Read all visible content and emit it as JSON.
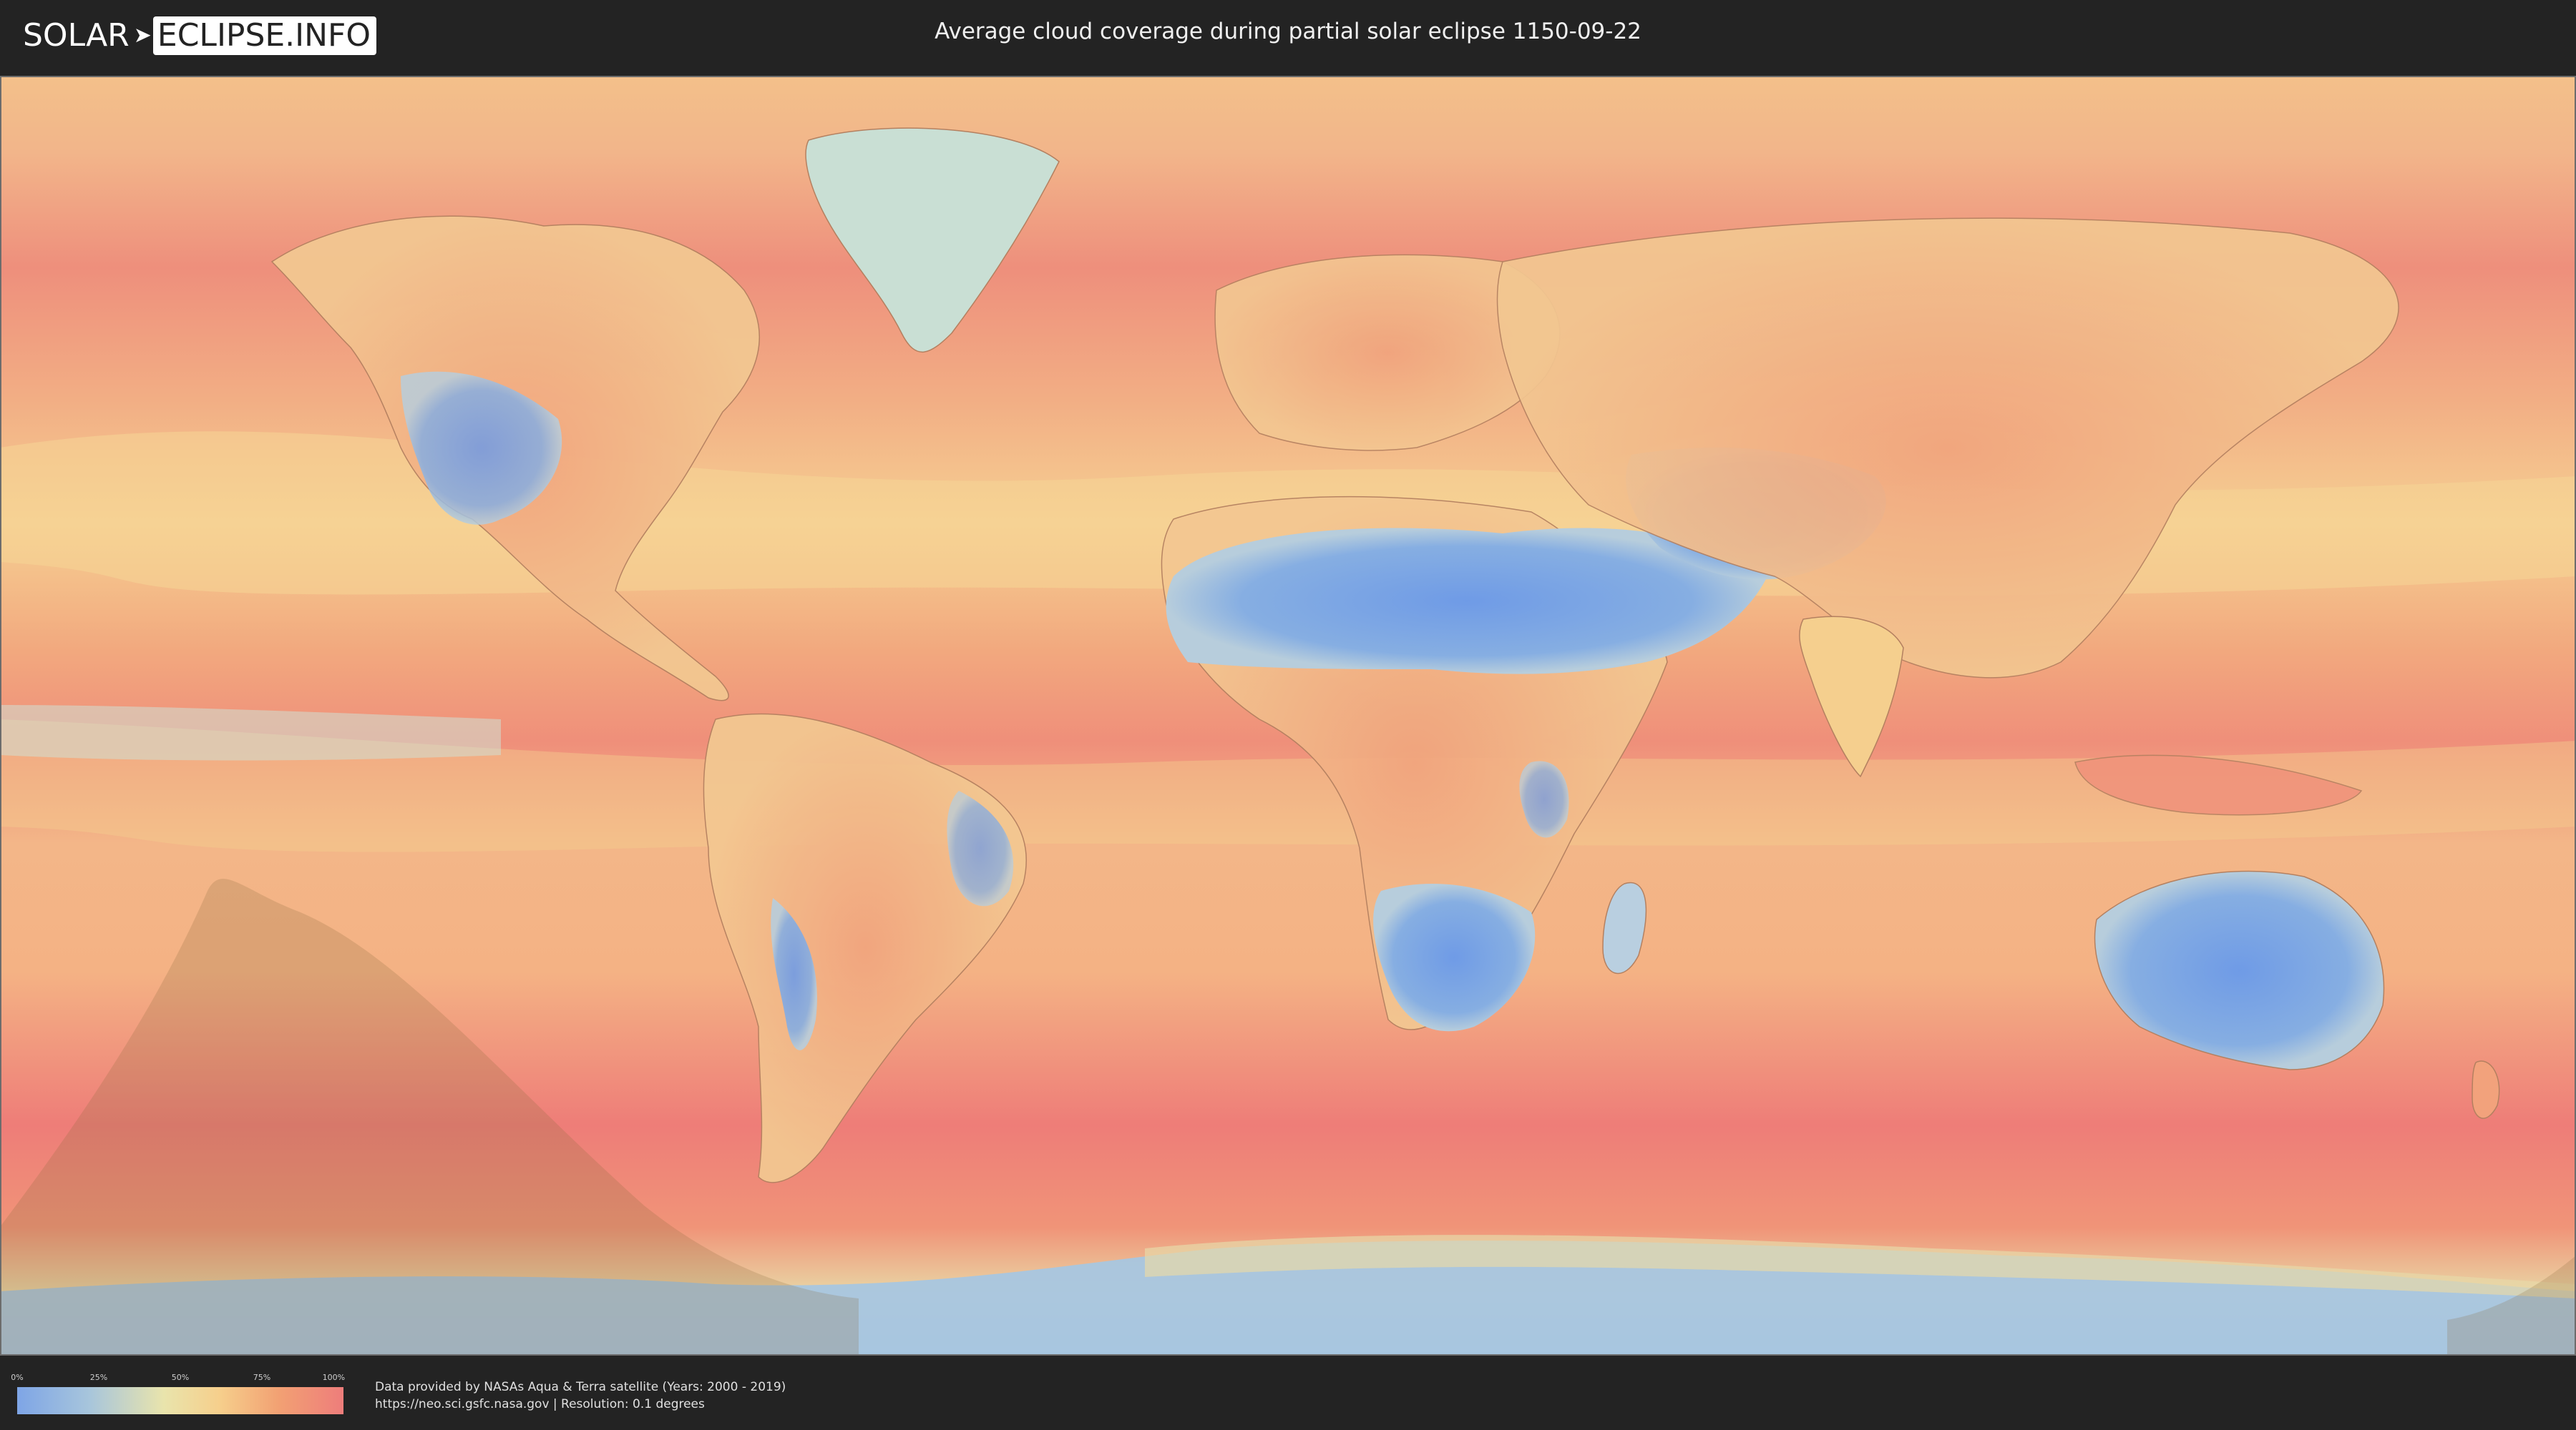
{
  "header": {
    "logo_left": "SOLAR",
    "logo_arrow": "➤",
    "logo_right": "ECLIPSE.INFO",
    "title": "Average cloud coverage during partial solar eclipse 1150-09-22"
  },
  "map": {
    "colors": {
      "clear_sky": "#7ea5e6",
      "low": "#a7c5dc",
      "mid": "#e9e4ac",
      "high": "#f6cf8c",
      "very_high": "#ee7d7b",
      "eclipse_shadow": "#8a6a3a"
    }
  },
  "legend": {
    "ticks": [
      "0%",
      "25%",
      "50%",
      "75%",
      "100%"
    ]
  },
  "credits": {
    "line1": "Data provided by NASAs Aqua & Terra satellite (Years: 2000 - 2019)",
    "line2": "https://neo.sci.gsfc.nasa.gov | Resolution: 0.1 degrees"
  }
}
